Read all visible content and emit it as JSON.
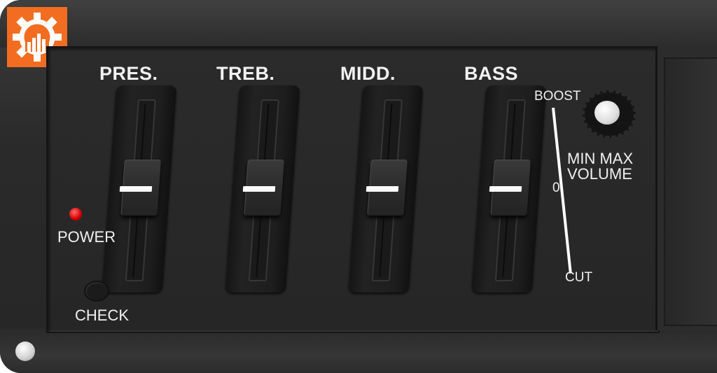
{
  "logo": {
    "icon": "gear-chart-icon",
    "color": "#f26d21"
  },
  "faders": [
    {
      "label": "PRES.",
      "level": 0.5
    },
    {
      "label": "TREB.",
      "level": 0.5
    },
    {
      "label": "MIDD.",
      "level": 0.5
    },
    {
      "label": "BASS",
      "level": 0.5
    }
  ],
  "scale": {
    "boost": "BOOST",
    "zero": "0",
    "cut": "CUT"
  },
  "volume": {
    "minmax": "MIN MAX",
    "label": "VOLUME"
  },
  "power": {
    "label": "POWER",
    "led_color": "#d40000"
  },
  "check": {
    "label": "CHECK"
  }
}
